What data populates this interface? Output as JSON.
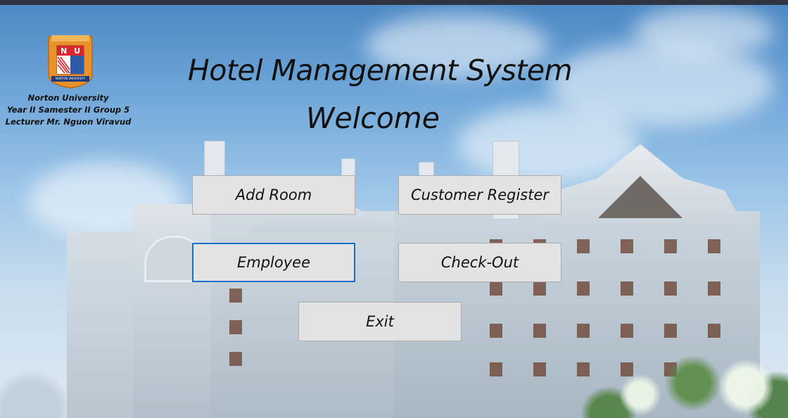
{
  "window": {
    "title": "Hotel Management System",
    "subtitle": "Welcome"
  },
  "university": {
    "name": "Norton University",
    "group_line": "Year II Samester II Group 5",
    "lecturer_line": "Lecturer Mr. Nguon Viravud",
    "logo_letters": "NU",
    "logo_banner": "NORTON UNIVERSITY"
  },
  "buttons": {
    "add_room": "Add Room",
    "customer_register": "Customer Register",
    "employee": "Employee",
    "check_out": "Check-Out",
    "exit": "Exit"
  },
  "focused_button": "employee",
  "colors": {
    "focus_border": "#1a6fc9",
    "button_bg": "#e3e3e3",
    "logo_orange": "#e8902a",
    "logo_red": "#d8262c"
  },
  "icons": {
    "logo": "university-crest-icon"
  }
}
